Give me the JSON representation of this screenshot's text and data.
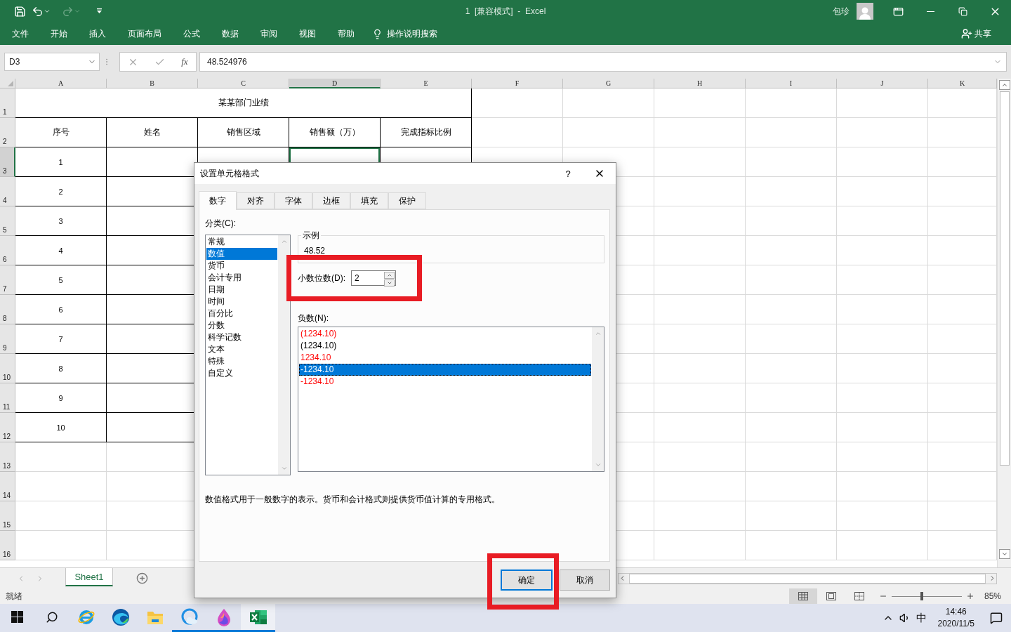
{
  "title_bar": {
    "title": "1  [兼容模式]  -  Excel",
    "user": "包珍"
  },
  "ribbon_tabs": [
    "文件",
    "开始",
    "插入",
    "页面布局",
    "公式",
    "数据",
    "审阅",
    "视图",
    "帮助"
  ],
  "tell_me": "操作说明搜索",
  "share": "共享",
  "formula_bar": {
    "name_box": "D3",
    "function_symbol": "fx",
    "value": "48.524976"
  },
  "sheet": {
    "columns": [
      {
        "label": "A",
        "selected": false
      },
      {
        "label": "B",
        "selected": false
      },
      {
        "label": "C",
        "selected": false
      },
      {
        "label": "D",
        "selected": true
      },
      {
        "label": "E",
        "selected": false
      },
      {
        "label": "F",
        "selected": false
      },
      {
        "label": "G",
        "selected": false
      },
      {
        "label": "H",
        "selected": false
      },
      {
        "label": "I",
        "selected": false
      },
      {
        "label": "J",
        "selected": false
      },
      {
        "label": "K",
        "selected": false
      }
    ],
    "rows": [
      {
        "label": "1",
        "selected": false
      },
      {
        "label": "2",
        "selected": false
      },
      {
        "label": "3",
        "selected": true
      },
      {
        "label": "4",
        "selected": false
      },
      {
        "label": "5",
        "selected": false
      },
      {
        "label": "6",
        "selected": false
      },
      {
        "label": "7",
        "selected": false
      },
      {
        "label": "8",
        "selected": false
      },
      {
        "label": "9",
        "selected": false
      },
      {
        "label": "10",
        "selected": false
      },
      {
        "label": "11",
        "selected": false
      },
      {
        "label": "12",
        "selected": false
      },
      {
        "label": "13",
        "selected": false
      },
      {
        "label": "14",
        "selected": false
      },
      {
        "label": "15",
        "selected": false
      },
      {
        "label": "16",
        "selected": false
      }
    ],
    "title": "某某部门业绩",
    "headers": [
      "序号",
      "姓名",
      "销售区域",
      "销售额（万）",
      "完成指标比例"
    ],
    "records": [
      "1",
      "2",
      "3",
      "4",
      "5",
      "6",
      "7",
      "8",
      "9",
      "10"
    ]
  },
  "sheet_tabs": [
    {
      "label": "Sheet1",
      "selected": true
    }
  ],
  "status_bar": {
    "status": "就绪",
    "views": [
      {
        "kind": "normal",
        "selected": true
      },
      {
        "kind": "page-layout",
        "selected": false
      },
      {
        "kind": "page-break",
        "selected": false
      }
    ],
    "zoom": {
      "level": 0.43,
      "reading": "85%"
    }
  },
  "dialog": {
    "title": "设置单元格格式",
    "help": "?",
    "tabs": [
      {
        "label": "数字",
        "selected": true
      },
      {
        "label": "对齐",
        "selected": false
      },
      {
        "label": "字体",
        "selected": false
      },
      {
        "label": "边框",
        "selected": false
      },
      {
        "label": "填充",
        "selected": false
      },
      {
        "label": "保护",
        "selected": false
      }
    ],
    "category_label": "分类(C):",
    "categories": [
      {
        "label": "常规",
        "selected": false
      },
      {
        "label": "数值",
        "selected": true
      },
      {
        "label": "货币",
        "selected": false
      },
      {
        "label": "会计专用",
        "selected": false
      },
      {
        "label": "日期",
        "selected": false
      },
      {
        "label": "时间",
        "selected": false
      },
      {
        "label": "百分比",
        "selected": false
      },
      {
        "label": "分数",
        "selected": false
      },
      {
        "label": "科学记数",
        "selected": false
      },
      {
        "label": "文本",
        "selected": false
      },
      {
        "label": "特殊",
        "selected": false
      },
      {
        "label": "自定义",
        "selected": false
      }
    ],
    "sample_label": "示例",
    "sample": "48.52",
    "decimals_label": "小数位数(D):",
    "decimals": "2",
    "decimals_highlighted": true,
    "negatives_label": "负数(N):",
    "negatives": [
      {
        "label": "(1234.10)",
        "color": "#ff0000",
        "selected": false
      },
      {
        "label": "(1234.10)",
        "color": "#000000",
        "selected": false
      },
      {
        "label": "1234.10",
        "color": "#ff0000",
        "selected": false
      },
      {
        "label": "-1234.10",
        "color": "#000000",
        "selected": true
      },
      {
        "label": "-1234.10",
        "color": "#ff0000",
        "selected": false
      }
    ],
    "description": "数值格式用于一般数字的表示。货币和会计格式则提供货币值计算的专用格式。",
    "buttons": [
      {
        "label": "确定",
        "default": true,
        "highlighted": true
      },
      {
        "label": "取消",
        "default": false,
        "highlighted": false
      }
    ]
  },
  "taskbar": {
    "apps": [
      {
        "kind": "ie",
        "running": false,
        "selected": false
      },
      {
        "kind": "edge",
        "running": false,
        "selected": false
      },
      {
        "kind": "explorer",
        "running": false,
        "selected": false
      },
      {
        "kind": "browser",
        "running": true,
        "selected": false
      },
      {
        "kind": "paint",
        "running": true,
        "selected": false
      },
      {
        "kind": "excel",
        "running": true,
        "selected": true
      }
    ],
    "ime": "中",
    "time": "14:46",
    "date": "2020/11/5"
  }
}
